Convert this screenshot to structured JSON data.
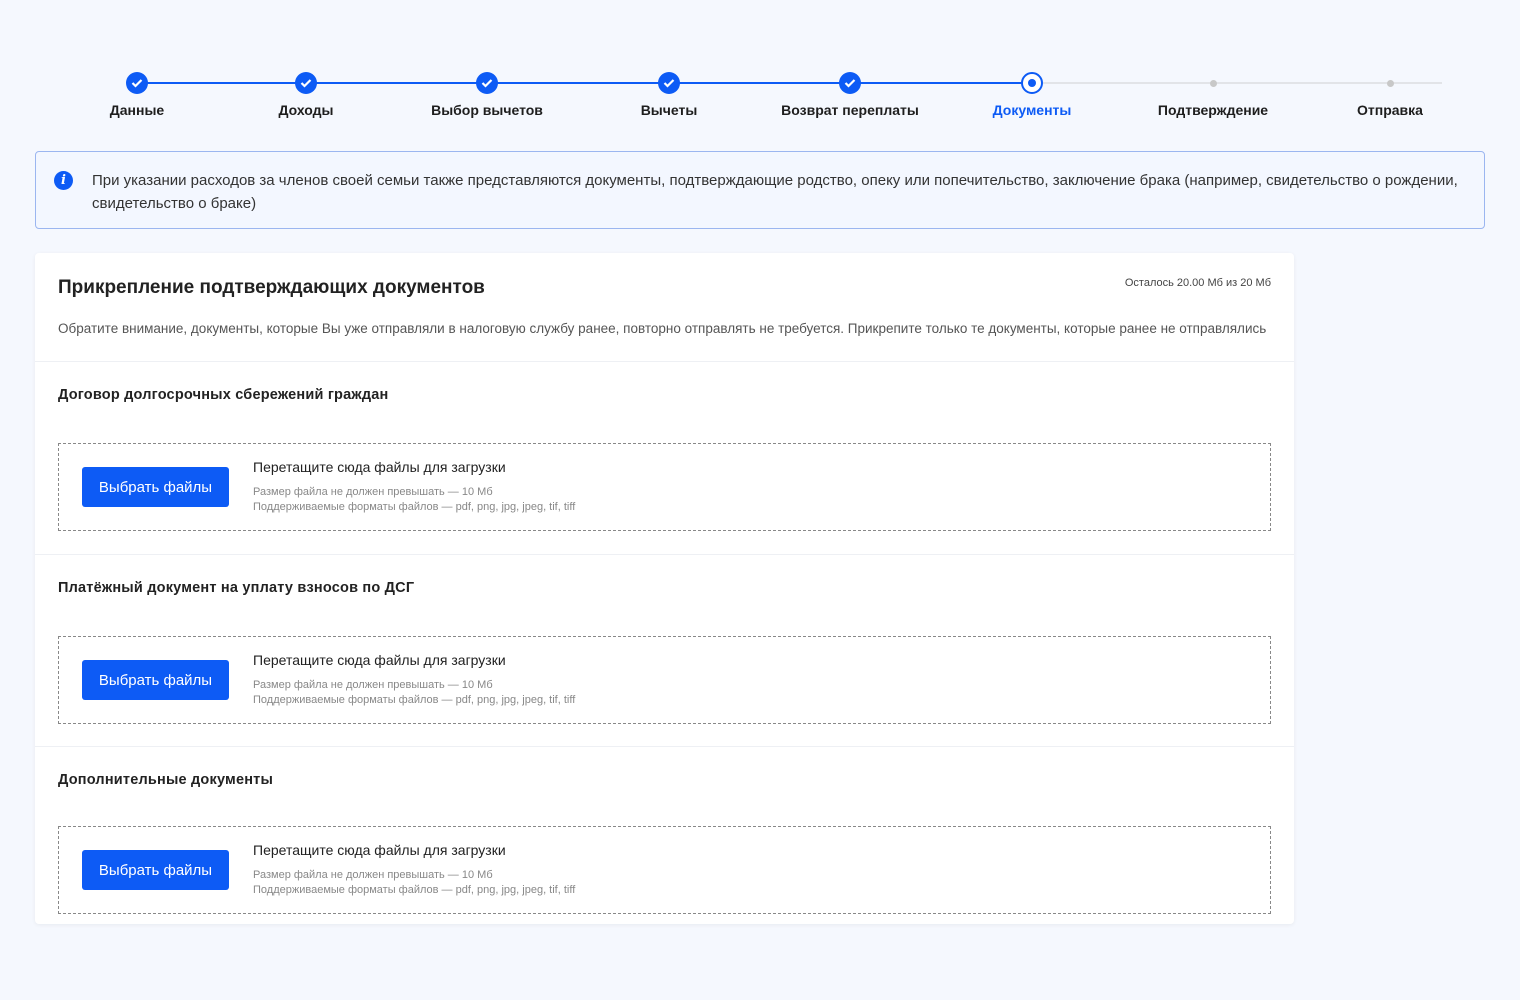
{
  "stepper": {
    "steps": [
      {
        "label": "Данные",
        "state": "done"
      },
      {
        "label": "Доходы",
        "state": "done"
      },
      {
        "label": "Выбор вычетов",
        "state": "done"
      },
      {
        "label": "Вычеты",
        "state": "done"
      },
      {
        "label": "Возврат переплаты",
        "state": "done"
      },
      {
        "label": "Документы",
        "state": "current"
      },
      {
        "label": "Подтверждение",
        "state": "todo"
      },
      {
        "label": "Отправка",
        "state": "todo"
      }
    ]
  },
  "info": {
    "text": "При указании расходов за членов своей семьи также представляются документы, подтверждающие родство, опеку или попечительство, заключение брака (например, свидетельство о рождении, свидетельство о браке)"
  },
  "card": {
    "title": "Прикрепление подтверждающих документов",
    "quota": "Осталось 20.00 Мб из 20 Мб",
    "note": "Обратите внимание, документы, которые Вы уже отправляли в налоговую службу ранее, повторно отправлять не требуется. Прикрепите только те документы, которые ранее не отправлялись",
    "sections": [
      {
        "title": "Договор долгосрочных сбережений граждан",
        "button": "Выбрать файлы",
        "drop_text": "Перетащите сюда файлы для загрузки",
        "size_hint": "Размер файла не должен превышать — 10 Мб",
        "format_hint": "Поддерживаемые форматы файлов — pdf, png, jpg, jpeg, tif, tiff"
      },
      {
        "title": "Платёжный документ на уплату взносов по ДСГ",
        "button": "Выбрать файлы",
        "drop_text": "Перетащите сюда файлы для загрузки",
        "size_hint": "Размер файла не должен превышать — 10 Мб",
        "format_hint": "Поддерживаемые форматы файлов — pdf, png, jpg, jpeg, tif, tiff"
      },
      {
        "title": "Дополнительные документы",
        "button": "Выбрать файлы",
        "drop_text": "Перетащите сюда файлы для загрузки",
        "size_hint": "Размер файла не должен превышать — 10 Мб",
        "format_hint": "Поддерживаемые форматы файлов — pdf, png, jpg, jpeg, tif, tiff"
      }
    ]
  },
  "colors": {
    "accent": "#0d5bf5",
    "pending": "#c8c8c8"
  }
}
